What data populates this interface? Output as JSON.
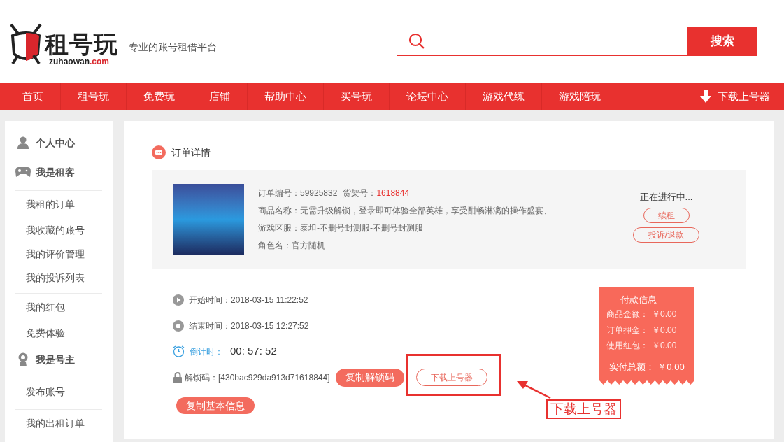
{
  "header": {
    "logo": {
      "mark": "租号玩",
      "domain": "zuhaowan",
      "domain_suffix": ".com"
    },
    "tagline": "专业的账号租借平台",
    "search": {
      "button": "搜索"
    }
  },
  "nav": {
    "items": [
      "首页",
      "租号玩",
      "免费玩",
      "店铺",
      "帮助中心",
      "买号玩",
      "论坛中心",
      "游戏代练",
      "游戏陪玩"
    ],
    "download": "下载上号器"
  },
  "sidebar": {
    "items": [
      {
        "kind": "heading",
        "label": "个人中心",
        "divider_above": false
      },
      {
        "kind": "heading",
        "label": "我是租客",
        "divider_above": false
      },
      {
        "kind": "link",
        "label": "我租的订单",
        "divider_above": true
      },
      {
        "kind": "link",
        "label": "我收藏的账号",
        "divider_above": false
      },
      {
        "kind": "link",
        "label": "我的评价管理",
        "divider_above": false
      },
      {
        "kind": "link",
        "label": "我的投诉列表",
        "divider_above": false
      },
      {
        "kind": "link",
        "label": "我的红包",
        "divider_above": true
      },
      {
        "kind": "link",
        "label": "免费体验",
        "divider_above": false
      },
      {
        "kind": "heading",
        "label": "我是号主",
        "divider_above": false
      },
      {
        "kind": "link",
        "label": "发布账号",
        "divider_above": true
      },
      {
        "kind": "link",
        "label": "我的出租订单",
        "divider_above": true
      }
    ]
  },
  "order": {
    "title": "订单详情",
    "order_number": "订单编号：59925832",
    "shelf_label": "货架号：",
    "shelf_number": "1618844",
    "details": [
      "商品名称：无需升级解锁，登录即可体验全部英雄，享受酣畅淋漓的操作盛宴、",
      "游戏区服：泰坦-不删号封测服-不删号封测服",
      "角色名：官方随机"
    ],
    "status": "正在进行中...",
    "actions": [
      "续租",
      "投诉/退款"
    ]
  },
  "times": [
    {
      "kind": "start",
      "label": "开始时间：",
      "value": "2018-03-15 11:22:52"
    },
    {
      "kind": "end",
      "label": "结束时间：",
      "value": "2018-03-15 12:27:52"
    },
    {
      "kind": "countdown",
      "label": "倒计时：",
      "value": "00: 57: 52"
    },
    {
      "kind": "unlock",
      "label": "解锁码：",
      "value": "[430bac929da913d71618844]"
    }
  ],
  "unlock_buttons": {
    "copy": "复制解锁码",
    "download": "下载上号器"
  },
  "copy_info": "复制基本信息",
  "payment": {
    "title": "付款信息",
    "rows": [
      {
        "label": "商品金额：",
        "value": "￥0.00"
      },
      {
        "label": "订单押金：",
        "value": "￥0.00"
      },
      {
        "label": "使用红包：",
        "value": "￥0.00"
      }
    ],
    "total": {
      "label": "实付总额：",
      "value": "￥0.00"
    }
  },
  "annotation": {
    "label": "下载上号器"
  }
}
